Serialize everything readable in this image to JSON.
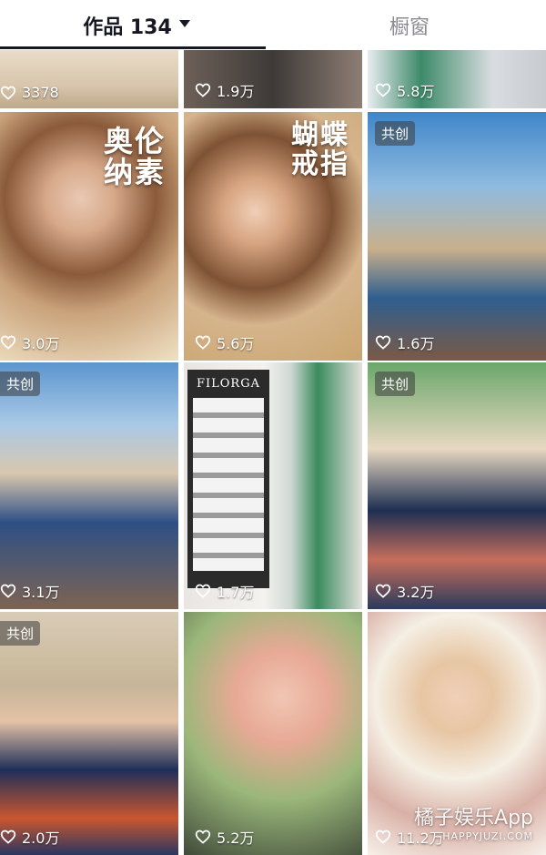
{
  "tabs": {
    "works_label": "作品 134",
    "window_label": "橱窗"
  },
  "posts": [
    {
      "likes": "3378",
      "badge": ""
    },
    {
      "likes": "1.9万",
      "badge": ""
    },
    {
      "likes": "5.8万",
      "badge": ""
    },
    {
      "likes": "3.0万",
      "badge": "",
      "overlay": "奥伦\n纳素"
    },
    {
      "likes": "5.6万",
      "badge": "",
      "overlay": "蝴蝶\n戒指"
    },
    {
      "likes": "1.6万",
      "badge": "共创"
    },
    {
      "likes": "3.1万",
      "badge": "共创"
    },
    {
      "likes": "1.7万",
      "badge": "",
      "sign": "FILORGA"
    },
    {
      "likes": "3.2万",
      "badge": "共创"
    },
    {
      "likes": "2.0万",
      "badge": "共创"
    },
    {
      "likes": "5.2万",
      "badge": ""
    },
    {
      "likes": "11.2万",
      "badge": ""
    }
  ],
  "watermark": {
    "main": "橘子娱乐App",
    "sub": "HAPPYJUZI.COM"
  },
  "colors": {
    "tab_active": "#161823",
    "tab_inactive": "#8a8b91"
  }
}
